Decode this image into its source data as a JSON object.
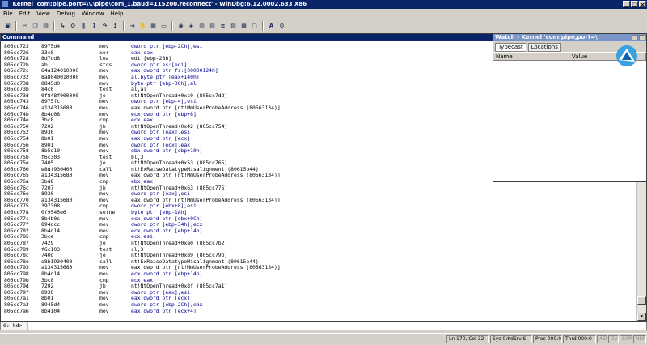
{
  "window": {
    "title": "Kernel 'com:pipe,port=\\\\.\\pipe\\com_1,baud=115200,reconnect' - WinDbg:6.12.0002.633 X86"
  },
  "menu": [
    "File",
    "Edit",
    "View",
    "Debug",
    "Window",
    "Help"
  ],
  "toolbar": {
    "icons": [
      "open-icon",
      "cut-icon",
      "copy-icon",
      "paste-icon",
      "go-icon",
      "restart-icon",
      "break-icon",
      "step-into-icon",
      "step-over-icon",
      "step-out-icon",
      "run-to-cursor-icon",
      "breakpoint-icon",
      "source-mode-icon",
      "command-icon",
      "watch-icon",
      "locals-icon",
      "registers-icon",
      "memory-icon",
      "call-stack-icon",
      "disassembly-icon",
      "scratch-pad-icon",
      "source-icon",
      "font-icon",
      "options-icon"
    ],
    "font_label": "AA"
  },
  "command_window": {
    "title": "Command",
    "rows": [
      {
        "addr": "805cc723",
        "op": "8975d4",
        "mn": "mov",
        "arg": "dword ptr [ebp-2Ch],esi",
        "color": "blue"
      },
      {
        "addr": "805cc726",
        "op": "33c0",
        "mn": "xor",
        "arg": "eax,eax",
        "color": "blue"
      },
      {
        "addr": "805cc728",
        "op": "8d7dd8",
        "mn": "lea",
        "arg": "edi,[ebp-28h]",
        "color": "plain"
      },
      {
        "addr": "805cc72b",
        "op": "ab",
        "mn": "stos",
        "arg": "dword ptr es:[edi]",
        "color": "blue"
      },
      {
        "addr": "805cc72c",
        "op": "64a124010000",
        "mn": "mov",
        "arg": "eax,dword ptr fs:[00000124h]",
        "color": "blue"
      },
      {
        "addr": "805cc732",
        "op": "8a8040010000",
        "mn": "mov",
        "arg": "al,byte ptr [eax+140h]",
        "color": "blue"
      },
      {
        "addr": "805cc738",
        "op": "8845d0",
        "mn": "mov",
        "arg": "byte ptr [ebp-30h],al",
        "color": "blue"
      },
      {
        "addr": "805cc73b",
        "op": "84c0",
        "mn": "test",
        "arg": "al,al",
        "color": "plain"
      },
      {
        "addr": "805cc73d",
        "op": "0f848f000000",
        "mn": "je",
        "arg": "nt!NtOpenThread+0xc0 (805cc7d2)",
        "color": "plain"
      },
      {
        "addr": "805cc743",
        "op": "8975fc",
        "mn": "mov",
        "arg": "dword ptr [ebp-4],esi",
        "color": "blue"
      },
      {
        "addr": "805cc746",
        "op": "a134315680",
        "mn": "mov",
        "arg": "eax,dword ptr [nt!MmUserProbeAddress (80563134)]",
        "color": "plain"
      },
      {
        "addr": "805cc74b",
        "op": "8b4d08",
        "mn": "mov",
        "arg": "ecx,dword ptr [ebp+8]",
        "color": "blue"
      },
      {
        "addr": "805cc74e",
        "op": "3bc8",
        "mn": "cmp",
        "arg": "ecx,eax",
        "color": "blue"
      },
      {
        "addr": "805cc750",
        "op": "7202",
        "mn": "jb",
        "arg": "nt!NtOpenThread+0x42 (805cc754)",
        "color": "plain"
      },
      {
        "addr": "805cc752",
        "op": "8930",
        "mn": "mov",
        "arg": "dword ptr [eax],esi",
        "color": "blue"
      },
      {
        "addr": "805cc754",
        "op": "8b01",
        "mn": "mov",
        "arg": "eax,dword ptr [ecx]",
        "color": "blue"
      },
      {
        "addr": "805cc756",
        "op": "8901",
        "mn": "mov",
        "arg": "dword ptr [ecx],eax",
        "color": "blue"
      },
      {
        "addr": "805cc758",
        "op": "8b5d10",
        "mn": "mov",
        "arg": "ebx,dword ptr [ebp+10h]",
        "color": "blue"
      },
      {
        "addr": "805cc75b",
        "op": "f6c303",
        "mn": "test",
        "arg": "bl,3",
        "color": "plain"
      },
      {
        "addr": "805cc75e",
        "op": "7405",
        "mn": "je",
        "arg": "nt!NtOpenThread+0x53 (805cc765)",
        "color": "plain"
      },
      {
        "addr": "805cc760",
        "op": "e8df930400",
        "mn": "call",
        "arg": "nt!ExRaiseDatatypeMisalignment (80615b44)",
        "color": "plain"
      },
      {
        "addr": "805cc765",
        "op": "a134315680",
        "mn": "mov",
        "arg": "eax,dword ptr [nt!MmUserProbeAddress (80563134)]",
        "color": "plain"
      },
      {
        "addr": "805cc76a",
        "op": "3bd8",
        "mn": "cmp",
        "arg": "ebx,eax",
        "color": "blue"
      },
      {
        "addr": "805cc76c",
        "op": "7207",
        "mn": "jb",
        "arg": "nt!NtOpenThread+0x63 (805cc775)",
        "color": "plain"
      },
      {
        "addr": "805cc76e",
        "op": "8930",
        "mn": "mov",
        "arg": "dword ptr [eax],esi",
        "color": "blue"
      },
      {
        "addr": "805cc770",
        "op": "a134315680",
        "mn": "mov",
        "arg": "eax,dword ptr [nt!MmUserProbeAddress (80563134)]",
        "color": "plain"
      },
      {
        "addr": "805cc775",
        "op": "397308",
        "mn": "cmp",
        "arg": "dword ptr [ebx+8],esi",
        "color": "blue"
      },
      {
        "addr": "805cc778",
        "op": "0f9545e6",
        "mn": "setne",
        "arg": "byte ptr [ebp-1Ah]",
        "color": "blue"
      },
      {
        "addr": "805cc77c",
        "op": "8b4b0c",
        "mn": "mov",
        "arg": "ecx,dword ptr [ebx+0Ch]",
        "color": "blue"
      },
      {
        "addr": "805cc77f",
        "op": "894dcc",
        "mn": "mov",
        "arg": "dword ptr [ebp-34h],ecx",
        "color": "blue"
      },
      {
        "addr": "805cc782",
        "op": "8b4d14",
        "mn": "mov",
        "arg": "ecx,dword ptr [ebp+14h]",
        "color": "blue"
      },
      {
        "addr": "805cc785",
        "op": "3bce",
        "mn": "cmp",
        "arg": "ecx,esi",
        "color": "blue"
      },
      {
        "addr": "805cc787",
        "op": "7429",
        "mn": "je",
        "arg": "nt!NtOpenThread+0xa0 (805cc7b2)",
        "color": "plain"
      },
      {
        "addr": "805cc789",
        "op": "f6c103",
        "mn": "test",
        "arg": "cl,3",
        "color": "plain"
      },
      {
        "addr": "805cc78c",
        "op": "740d",
        "mn": "je",
        "arg": "nt!NtOpenThread+0x89 (805cc79b)",
        "color": "plain"
      },
      {
        "addr": "805cc78e",
        "op": "e8b1930400",
        "mn": "call",
        "arg": "nt!ExRaiseDatatypeMisalignment (80615b44)",
        "color": "plain"
      },
      {
        "addr": "805cc793",
        "op": "a134315680",
        "mn": "mov",
        "arg": "eax,dword ptr [nt!MmUserProbeAddress (80563134)]",
        "color": "plain"
      },
      {
        "addr": "805cc798",
        "op": "8b4d14",
        "mn": "mov",
        "arg": "ecx,dword ptr [ebp+14h]",
        "color": "blue"
      },
      {
        "addr": "805cc79b",
        "op": "3bc8",
        "mn": "cmp",
        "arg": "ecx,eax",
        "color": "blue"
      },
      {
        "addr": "805cc79d",
        "op": "7202",
        "mn": "jb",
        "arg": "nt!NtOpenThread+0x8f (805cc7a1)",
        "color": "plain"
      },
      {
        "addr": "805cc79f",
        "op": "8930",
        "mn": "mov",
        "arg": "dword ptr [eax],esi",
        "color": "blue"
      },
      {
        "addr": "805cc7a1",
        "op": "8b01",
        "mn": "mov",
        "arg": "eax,dword ptr [ecx]",
        "color": "blue"
      },
      {
        "addr": "805cc7a3",
        "op": "8945d4",
        "mn": "mov",
        "arg": "dword ptr [ebp-2Ch],eax",
        "color": "blue"
      },
      {
        "addr": "805cc7a6",
        "op": "8b4104",
        "mn": "mov",
        "arg": "eax,dword ptr [ecx+4]",
        "color": "blue"
      }
    ],
    "prompt": "0: kd>",
    "input_value": ""
  },
  "watch_window": {
    "title": "Watch - Kernel 'com:pipe,port=\\",
    "tabs": [
      "Typecast",
      "Locations"
    ],
    "columns": [
      "Name",
      "Value"
    ]
  },
  "status_bar": {
    "cells": [
      {
        "text": "Ln 170, Col 32",
        "dim": false
      },
      {
        "text": "Sys 0:KdSrv:S",
        "dim": false
      },
      {
        "text": "Proc 000:0",
        "dim": false
      },
      {
        "text": "Thrd 000:0",
        "dim": false
      },
      {
        "text": "ASM",
        "dim": true
      },
      {
        "text": "OVR",
        "dim": true
      },
      {
        "text": "CAPS",
        "dim": true
      },
      {
        "text": "NUM",
        "dim": true
      }
    ]
  },
  "colors": {
    "title_active": "#0a246a",
    "title_inactive": "#7a96c8",
    "disasm_arg_blue": "#00008b",
    "chrome": "#d4d0c8"
  }
}
